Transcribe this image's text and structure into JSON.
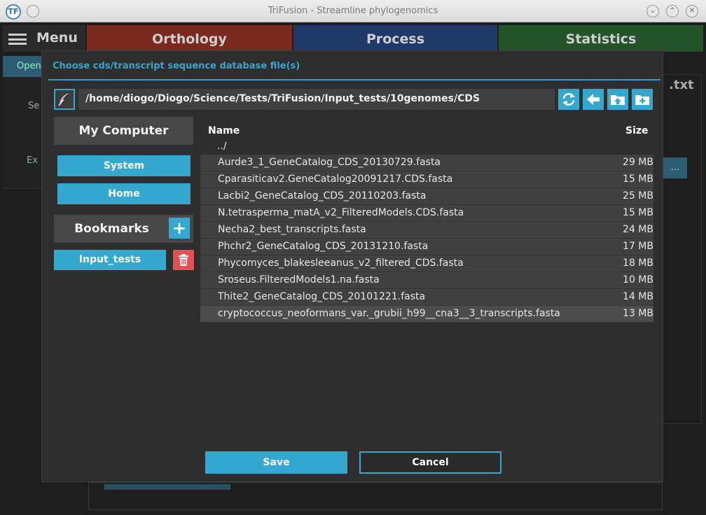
{
  "window": {
    "title": "TriFusion - Streamline phylogenomics",
    "logo_text": "TF",
    "minimize_glyph": "⌄",
    "maximize_glyph": "⌃",
    "close_glyph": "✕"
  },
  "background": {
    "menu_label": "Menu",
    "tabs": [
      {
        "label": "Orthology",
        "color": "#7a2a1e"
      },
      {
        "label": "Process",
        "color": "#1f3a68"
      },
      {
        "label": "Statistics",
        "color": "#24552a"
      }
    ],
    "sub_label": "Open",
    "side_text_1": "Se",
    "side_text_2": "Ex",
    "right_text": ".txt",
    "right_button": "..."
  },
  "dialog": {
    "title": "Choose cds/transcript sequence database file(s)",
    "path": "/home/diogo/Diogo/Science/Tests/TriFusion/Input_tests/10genomes/CDS",
    "sidebar": {
      "my_computer": "My Computer",
      "system": "System",
      "home": "Home",
      "bookmarks": "Bookmarks",
      "add_glyph": "+",
      "bookmark_items": [
        "Input_tests"
      ]
    },
    "columns": {
      "name": "Name",
      "size": "Size"
    },
    "parent_dir": "../",
    "files": [
      {
        "name": "Aurde3_1_GeneCatalog_CDS_20130729.fasta",
        "size": "29 MB",
        "selected": false
      },
      {
        "name": "Cparasiticav2.GeneCatalog20091217.CDS.fasta",
        "size": "15 MB",
        "selected": false
      },
      {
        "name": "Lacbi2_GeneCatalog_CDS_20110203.fasta",
        "size": "25 MB",
        "selected": false
      },
      {
        "name": "N.tetrasperma_matA_v2_FilteredModels.CDS.fasta",
        "size": "15 MB",
        "selected": false
      },
      {
        "name": "Necha2_best_transcripts.fasta",
        "size": "24 MB",
        "selected": false
      },
      {
        "name": "Phchr2_GeneCatalog_CDS_20131210.fasta",
        "size": "17 MB",
        "selected": false
      },
      {
        "name": "Phycomyces_blakesleeanus_v2_filtered_CDS.fasta",
        "size": "18 MB",
        "selected": false
      },
      {
        "name": "Sroseus.FilteredModels1.na.fasta",
        "size": "10 MB",
        "selected": false
      },
      {
        "name": "Thite2_GeneCatalog_CDS_20101221.fasta",
        "size": "14 MB",
        "selected": false
      },
      {
        "name": "cryptococcus_neoformans_var._grubii_h99__cna3__3_transcripts.fasta",
        "size": "13 MB",
        "selected": true
      }
    ],
    "save_label": "Save",
    "cancel_label": "Cancel"
  },
  "colors": {
    "accent": "#34a8ce",
    "delete": "#e35252",
    "dialog_bg": "#2e2e2e"
  }
}
